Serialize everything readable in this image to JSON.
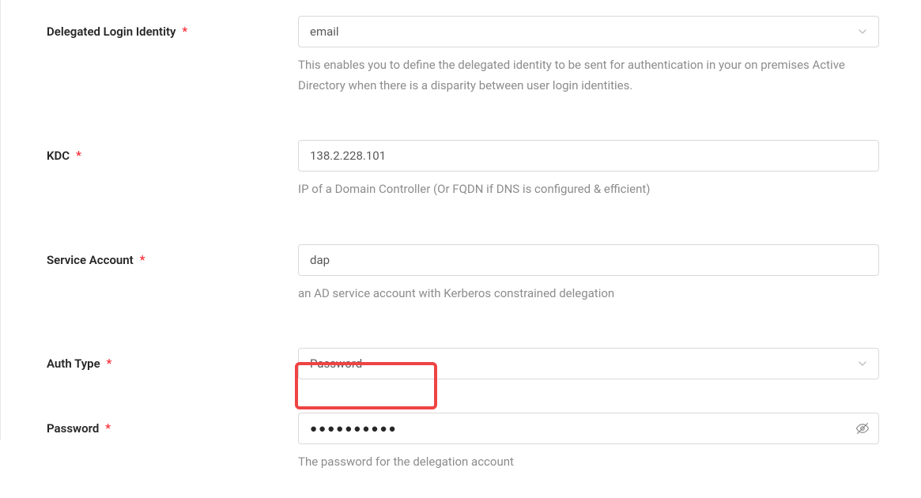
{
  "fields": {
    "delegatedIdentity": {
      "label": "Delegated Login Identity",
      "value": "email",
      "help": "This enables you to define the delegated identity to be sent for authentication in your on premises Active Directory when there is a disparity between user login identities."
    },
    "kdc": {
      "label": "KDC",
      "value": "138.2.228.101",
      "help": "IP of a Domain Controller (Or FQDN if DNS is configured & efficient)"
    },
    "serviceAccount": {
      "label": "Service Account",
      "value": "dap",
      "help": "an AD service account with Kerberos constrained delegation"
    },
    "authType": {
      "label": "Auth Type",
      "value": "Password"
    },
    "password": {
      "label": "Password",
      "value": "●●●●●●●●●●",
      "help": "The password for the delegation account"
    }
  },
  "requiredMark": "*"
}
